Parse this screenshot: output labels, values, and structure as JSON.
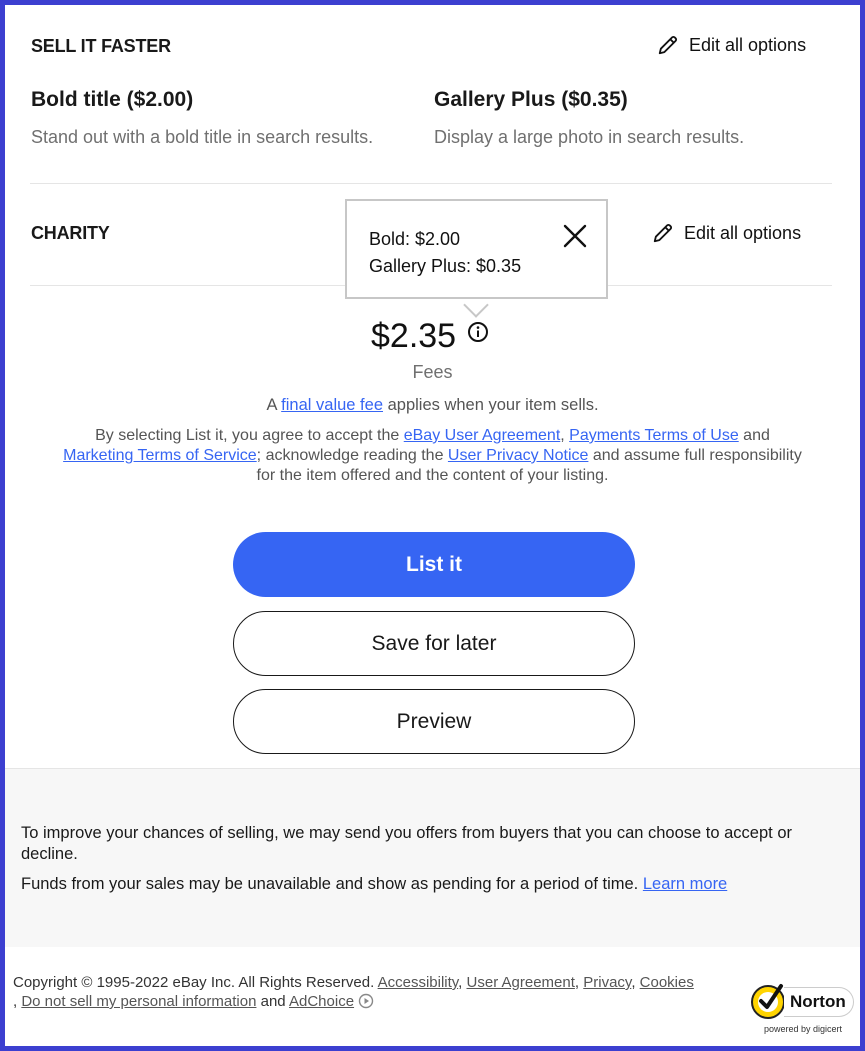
{
  "sell_faster": {
    "heading": "SELL IT FASTER",
    "edit_label": "Edit all options",
    "options": [
      {
        "title": "Bold title ($2.00)",
        "desc": "Stand out with a bold title in search results."
      },
      {
        "title": "Gallery Plus ($0.35)",
        "desc": "Display a large photo in search results."
      }
    ]
  },
  "charity": {
    "heading": "CHARITY",
    "edit_label": "Edit all options"
  },
  "tooltip": {
    "line1": "Bold: $2.00",
    "line2": "Gallery Plus: $0.35"
  },
  "fees": {
    "amount": "$2.35",
    "label": "Fees"
  },
  "final_value": {
    "prefix": "A",
    "link": "final value fee",
    "suffix": "applies when your item sells."
  },
  "legal": {
    "t1": "By selecting List it, you agree to accept the",
    "link_agreement": "eBay User Agreement",
    "comma1": ",",
    "link_payments": "Payments Terms of Use",
    "t2": "and",
    "link_marketing": "Marketing Terms of Service",
    "t3": "; acknowledge reading the",
    "link_privacy": "User Privacy Notice",
    "t4": "and assume full responsibility for the item offered and the content of your listing."
  },
  "buttons": {
    "list_it": "List it",
    "save_for_later": "Save for later",
    "preview": "Preview"
  },
  "info_panel": {
    "p1": "To improve your chances of selling, we may send you offers from buyers that you can choose to accept or decline.",
    "p2": "Funds from your sales may be unavailable and show as pending for a period of time.",
    "learn_more": "Learn more"
  },
  "footer": {
    "copyright": "Copyright © 1995-2022 eBay Inc. All Rights Reserved.",
    "accessibility": "Accessibility",
    "user_agreement": "User Agreement",
    "privacy": "Privacy",
    "cookies": "Cookies",
    "lead_comma": ",",
    "do_not_sell": "Do not sell my personal information",
    "and": "and",
    "adchoice": "AdChoice",
    "norton_brand": "Norton",
    "norton_powered": "powered by digicert"
  },
  "colors": {
    "accent": "#3665f3",
    "border_frame": "#3c3fd0",
    "panel_bg": "#f7f7f7"
  }
}
